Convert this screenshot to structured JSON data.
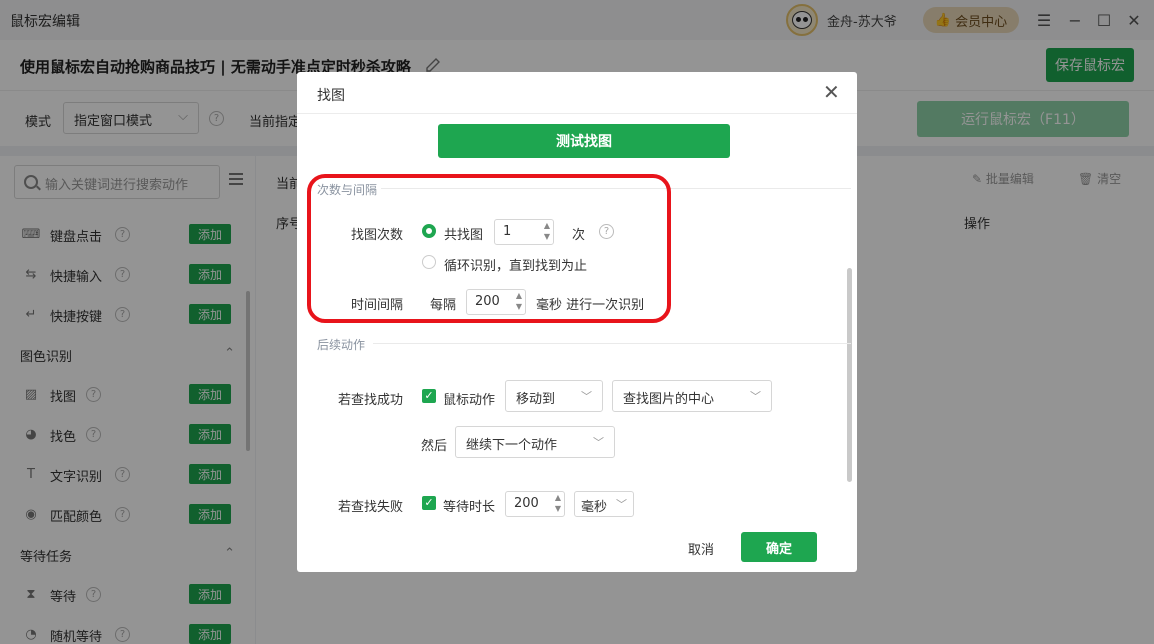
{
  "app": {
    "title": "鼠标宏编辑",
    "username": "金舟-苏大爷",
    "vip_label": "会员中心",
    "window_buttons": [
      "menu-icon",
      "minimize-icon",
      "maximize-icon",
      "close-icon"
    ]
  },
  "header": {
    "page_title": "使用鼠标宏自动抢购商品技巧 | 无需动手准点定时秒杀攻略",
    "save_label": "保存鼠标宏"
  },
  "toolbar": {
    "mode_label": "模式",
    "mode_value": "指定窗口模式",
    "current_label": "当前指定",
    "run_label": "运行鼠标宏（F11）"
  },
  "left_panel": {
    "search_placeholder": "输入关键词进行搜索动作",
    "add_label": "添加",
    "items": [
      {
        "label": "键盘点击",
        "icon": "keyboard-icon"
      },
      {
        "label": "快捷输入",
        "icon": "input-icon"
      },
      {
        "label": "快捷按键",
        "icon": "enter-key-icon"
      }
    ],
    "group_image": "图色识别",
    "image_items": [
      {
        "label": "找图",
        "icon": "image-icon"
      },
      {
        "label": "找色",
        "icon": "palette-icon"
      },
      {
        "label": "文字识别",
        "icon": "text-recognition-icon"
      },
      {
        "label": "匹配颜色",
        "icon": "color-match-icon"
      }
    ],
    "group_wait": "等待任务",
    "wait_items": [
      {
        "label": "等待",
        "icon": "hourglass-icon"
      },
      {
        "label": "随机等待",
        "icon": "random-wait-icon"
      }
    ]
  },
  "right_panel": {
    "current_label": "当前",
    "batch_edit": "批量编辑",
    "clear": "清空",
    "col_seq": "序号",
    "col_op": "操作"
  },
  "dialog": {
    "title": "找图",
    "test_button": "测试找图",
    "section_count": "次数与间隔",
    "find_count_label": "找图次数",
    "radio_total": "共找图",
    "count_value": "1",
    "count_unit": "次",
    "radio_loop": "循环识别，直到找到为止",
    "interval_label": "时间间隔",
    "every_label": "每隔",
    "interval_value": "200",
    "interval_suffix": "毫秒 进行一次识别",
    "section_follow": "后续动作",
    "success_label": "若查找成功",
    "mouse_action_label": "鼠标动作",
    "move_to": "移动到",
    "target": "查找图片的中心",
    "then_label": "然后",
    "then_value": "继续下一个动作",
    "fail_label": "若查找失败",
    "wait_label": "等待时长",
    "wait_value": "200",
    "wait_unit": "毫秒",
    "cancel": "取消",
    "ok": "确定"
  },
  "colors": {
    "primary": "#1ea650",
    "primary_disabled": "#8fd3a9",
    "highlight": "#e8141b",
    "vip_bg": "#e8d7b8"
  }
}
